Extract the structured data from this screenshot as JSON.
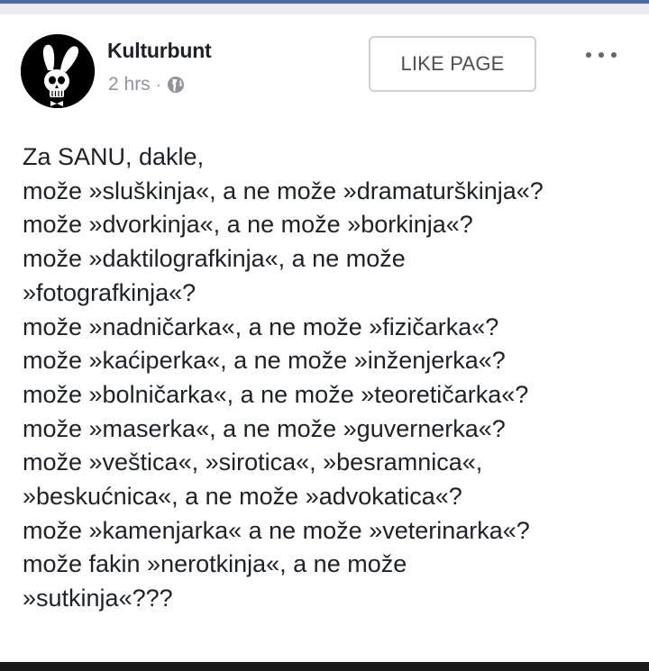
{
  "post": {
    "page_name": "Kulturbunt",
    "time": "2 hrs",
    "separator": "·",
    "privacy_icon": "globe-icon",
    "like_button_label": "LIKE PAGE",
    "more_icon": "more-options-icon",
    "avatar_icon": "bunny-skull-logo",
    "lines": [
      "Za SANU, dakle,",
      "može »sluškinja«, a ne može »dramaturškinja«?",
      "može »dvorkinja«, a ne može »borkinja«?",
      "može »daktilografkinja«, a ne može",
      "»fotografkinja«?",
      "može »nadničarka«, a ne može »fizičarka«?",
      "može »kaćiperka«, a ne može »inženjerka«?",
      "može »bolničarka«, a ne može »teoretičarka«?",
      "može »maserka«, a ne može »guvernerka«?",
      "može »veštica«, »sirotica«, »besramnica«,",
      "»beskućnica«, a ne može »advokatica«?",
      "može »kamenjarka« a ne može »veterinarka«?",
      "može fakin »nerotkinja«, a ne može",
      "»sutkinja«???"
    ]
  },
  "colors": {
    "text": "#1d2129",
    "meta": "#90949c",
    "accent": "#4a66a8"
  }
}
